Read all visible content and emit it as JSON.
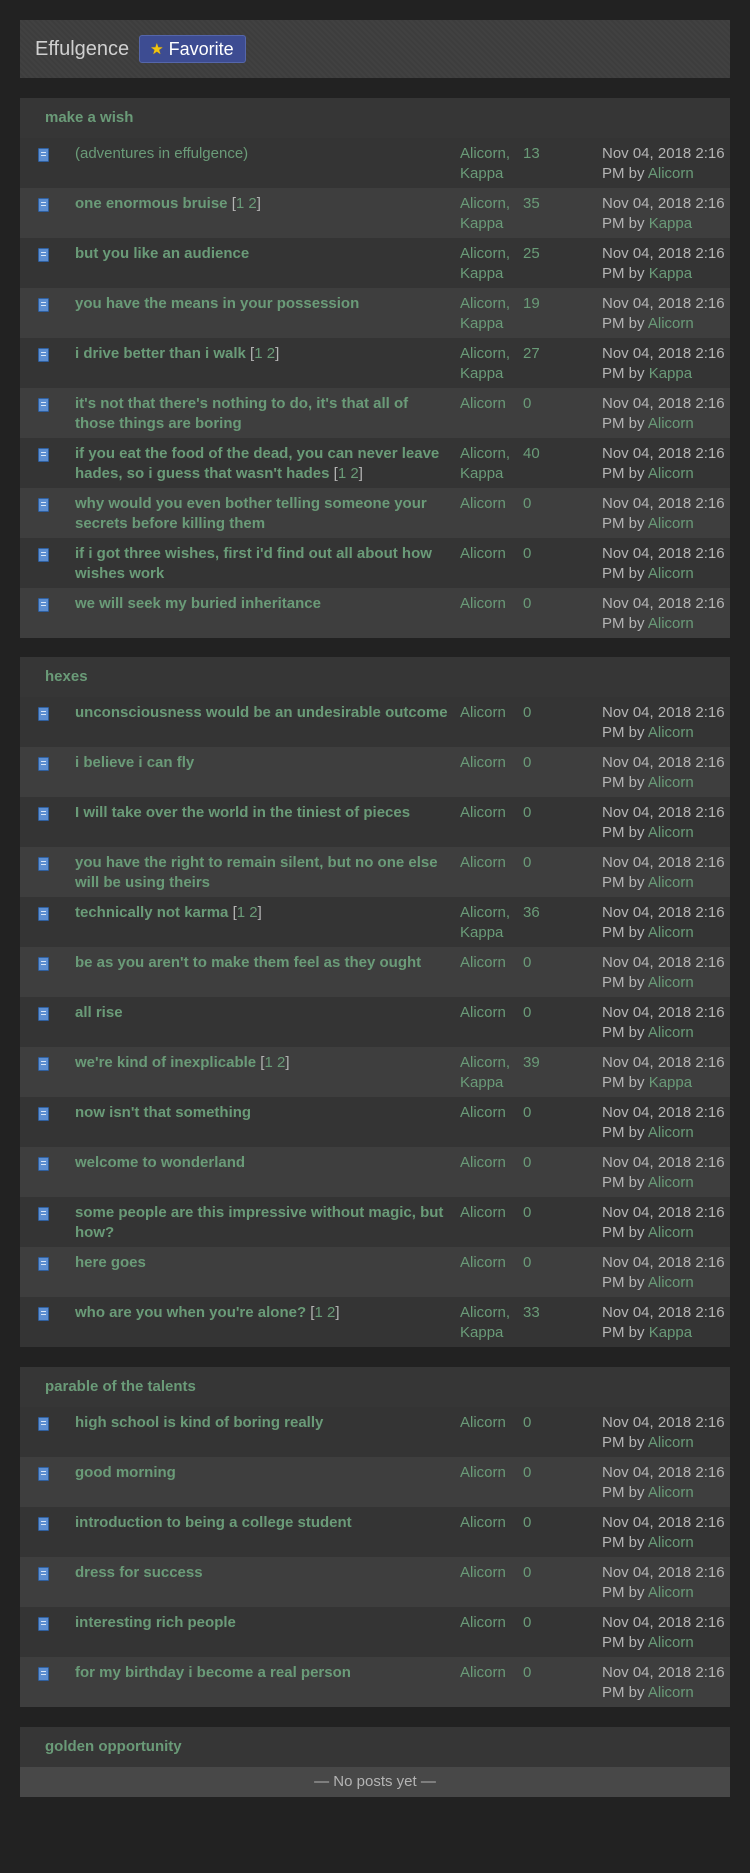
{
  "header": {
    "title": "Effulgence",
    "favorite_label": "Favorite"
  },
  "boards": [
    {
      "name": "make a wish",
      "rows": [
        {
          "title": "(adventures in effulgence)",
          "pages": [],
          "authors": "Alicorn, Kappa",
          "replies": "13",
          "last_time": "Nov 04, 2018 2:16 PM",
          "last_by": "Alicorn",
          "plain": true
        },
        {
          "title": "one enormous bruise",
          "pages": [
            "1",
            "2"
          ],
          "authors": "Alicorn, Kappa",
          "replies": "35",
          "last_time": "Nov 04, 2018 2:16 PM",
          "last_by": "Kappa"
        },
        {
          "title": "but you like an audience",
          "pages": [],
          "authors": "Alicorn, Kappa",
          "replies": "25",
          "last_time": "Nov 04, 2018 2:16 PM",
          "last_by": "Kappa"
        },
        {
          "title": "you have the means in your possession",
          "pages": [],
          "authors": "Alicorn, Kappa",
          "replies": "19",
          "last_time": "Nov 04, 2018 2:16 PM",
          "last_by": "Alicorn"
        },
        {
          "title": "i drive better than i walk",
          "pages": [
            "1",
            "2"
          ],
          "authors": "Alicorn, Kappa",
          "replies": "27",
          "last_time": "Nov 04, 2018 2:16 PM",
          "last_by": "Kappa"
        },
        {
          "title": "it's not that there's nothing to do, it's that all of those things are boring",
          "pages": [],
          "authors": "Alicorn",
          "replies": "0",
          "last_time": "Nov 04, 2018 2:16 PM",
          "last_by": "Alicorn"
        },
        {
          "title": "if you eat the food of the dead, you can never leave hades, so i guess that wasn't hades",
          "pages": [
            "1",
            "2"
          ],
          "authors": "Alicorn, Kappa",
          "replies": "40",
          "last_time": "Nov 04, 2018 2:16 PM",
          "last_by": "Alicorn"
        },
        {
          "title": "why would you even bother telling someone your secrets before killing them",
          "pages": [],
          "authors": "Alicorn",
          "replies": "0",
          "last_time": "Nov 04, 2018 2:16 PM",
          "last_by": "Alicorn"
        },
        {
          "title": "if i got three wishes, first i'd find out all about how wishes work",
          "pages": [],
          "authors": "Alicorn",
          "replies": "0",
          "last_time": "Nov 04, 2018 2:16 PM",
          "last_by": "Alicorn"
        },
        {
          "title": "we will seek my buried inheritance",
          "pages": [],
          "authors": "Alicorn",
          "replies": "0",
          "last_time": "Nov 04, 2018 2:16 PM",
          "last_by": "Alicorn"
        }
      ]
    },
    {
      "name": "hexes",
      "rows": [
        {
          "title": "unconsciousness would be an undesirable outcome",
          "pages": [],
          "authors": "Alicorn",
          "replies": "0",
          "last_time": "Nov 04, 2018 2:16 PM",
          "last_by": "Alicorn"
        },
        {
          "title": "i believe i can fly",
          "pages": [],
          "authors": "Alicorn",
          "replies": "0",
          "last_time": "Nov 04, 2018 2:16 PM",
          "last_by": "Alicorn"
        },
        {
          "title": "I will take over the world in the tiniest of pieces",
          "pages": [],
          "authors": "Alicorn",
          "replies": "0",
          "last_time": "Nov 04, 2018 2:16 PM",
          "last_by": "Alicorn"
        },
        {
          "title": "you have the right to remain silent, but no one else will be using theirs",
          "pages": [],
          "authors": "Alicorn",
          "replies": "0",
          "last_time": "Nov 04, 2018 2:16 PM",
          "last_by": "Alicorn"
        },
        {
          "title": "technically not karma",
          "pages": [
            "1",
            "2"
          ],
          "authors": "Alicorn, Kappa",
          "replies": "36",
          "last_time": "Nov 04, 2018 2:16 PM",
          "last_by": "Alicorn"
        },
        {
          "title": "be as you aren't to make them feel as they ought",
          "pages": [],
          "authors": "Alicorn",
          "replies": "0",
          "last_time": "Nov 04, 2018 2:16 PM",
          "last_by": "Alicorn"
        },
        {
          "title": "all rise",
          "pages": [],
          "authors": "Alicorn",
          "replies": "0",
          "last_time": "Nov 04, 2018 2:16 PM",
          "last_by": "Alicorn"
        },
        {
          "title": "we're kind of inexplicable",
          "pages": [
            "1",
            "2"
          ],
          "authors": "Alicorn, Kappa",
          "replies": "39",
          "last_time": "Nov 04, 2018 2:16 PM",
          "last_by": "Kappa"
        },
        {
          "title": "now isn't that something",
          "pages": [],
          "authors": "Alicorn",
          "replies": "0",
          "last_time": "Nov 04, 2018 2:16 PM",
          "last_by": "Alicorn"
        },
        {
          "title": "welcome to wonderland",
          "pages": [],
          "authors": "Alicorn",
          "replies": "0",
          "last_time": "Nov 04, 2018 2:16 PM",
          "last_by": "Alicorn"
        },
        {
          "title": "some people are this impressive without magic, but how?",
          "pages": [],
          "authors": "Alicorn",
          "replies": "0",
          "last_time": "Nov 04, 2018 2:16 PM",
          "last_by": "Alicorn"
        },
        {
          "title": "here goes",
          "pages": [],
          "authors": "Alicorn",
          "replies": "0",
          "last_time": "Nov 04, 2018 2:16 PM",
          "last_by": "Alicorn"
        },
        {
          "title": "who are you when you're alone?",
          "pages": [
            "1",
            "2"
          ],
          "authors": "Alicorn, Kappa",
          "replies": "33",
          "last_time": "Nov 04, 2018 2:16 PM",
          "last_by": "Kappa"
        }
      ]
    },
    {
      "name": "parable of the talents",
      "rows": [
        {
          "title": "high school is kind of boring really",
          "pages": [],
          "authors": "Alicorn",
          "replies": "0",
          "last_time": "Nov 04, 2018 2:16 PM",
          "last_by": "Alicorn"
        },
        {
          "title": "good morning",
          "pages": [],
          "authors": "Alicorn",
          "replies": "0",
          "last_time": "Nov 04, 2018 2:16 PM",
          "last_by": "Alicorn"
        },
        {
          "title": "introduction to being a college student",
          "pages": [],
          "authors": "Alicorn",
          "replies": "0",
          "last_time": "Nov 04, 2018 2:16 PM",
          "last_by": "Alicorn"
        },
        {
          "title": "dress for success",
          "pages": [],
          "authors": "Alicorn",
          "replies": "0",
          "last_time": "Nov 04, 2018 2:16 PM",
          "last_by": "Alicorn"
        },
        {
          "title": "interesting rich people",
          "pages": [],
          "authors": "Alicorn",
          "replies": "0",
          "last_time": "Nov 04, 2018 2:16 PM",
          "last_by": "Alicorn"
        },
        {
          "title": "for my birthday i become a real person",
          "pages": [],
          "authors": "Alicorn",
          "replies": "0",
          "last_time": "Nov 04, 2018 2:16 PM",
          "last_by": "Alicorn"
        }
      ]
    },
    {
      "name": "golden opportunity",
      "rows": [],
      "empty_text": "— No posts yet —"
    }
  ]
}
